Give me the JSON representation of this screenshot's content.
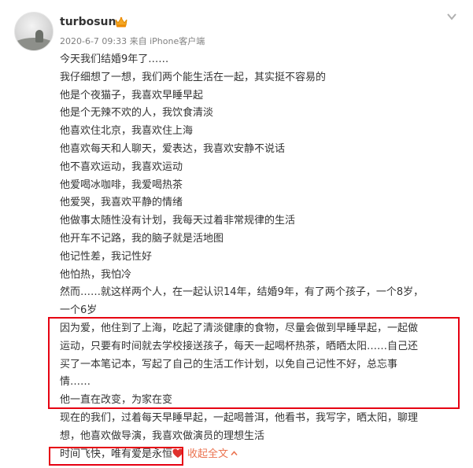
{
  "post": {
    "author": "turbosun",
    "meta": "2020-6-7 09:33 来自 iPhone客户端",
    "lines": [
      "今天我们结婚9年了……",
      "我仔细想了一想，我们两个能生活在一起，其实挺不容易的",
      "他是个夜猫子，我喜欢早睡早起",
      "他是个无辣不欢的人，我饮食清淡",
      "他喜欢住北京，我喜欢住上海",
      "他喜欢每天和人聊天，爱表达，我喜欢安静不说话",
      "他不喜欢运动，我喜欢运动",
      "他爱喝冰咖啡，我爱喝热茶",
      "他爱哭，我喜欢平静的情绪",
      "他做事太随性没有计划，我每天过着非常规律的生活",
      "他开车不记路，我的脑子就是活地图",
      "他记性差，我记性好",
      "他怕热，我怕冷",
      "然而……就这样两个人，在一起认识14年，结婚9年，有了两个孩子，一个8岁，",
      "一个6岁"
    ],
    "highlight_lines": [
      "因为爱，他住到了上海，吃起了清淡健康的食物，尽量会做到早睡早起，一起做",
      "运动，只要有时间就去学校接送孩子，每天一起喝杯热茶，晒晒太阳……自己还",
      "买了一本笔记本，写起了自己的生活工作计划，以免自己记性不好，总忘事",
      "情……",
      "他一直在改变，为家在变"
    ],
    "after_lines": [
      "现在的我们，过着每天早睡早起，一起喝普洱，他看书，我写字，晒太阳，聊理",
      "想，他喜欢做导演，我喜欢做演员的理想生活"
    ],
    "closing": "时间飞快，唯有爱是永恒",
    "collapse_label": "收起全文"
  },
  "colors": {
    "highlight_border": "#e60012",
    "link": "#eb7350",
    "heart": "#e0312d",
    "text": "#333333",
    "meta": "#808080"
  }
}
